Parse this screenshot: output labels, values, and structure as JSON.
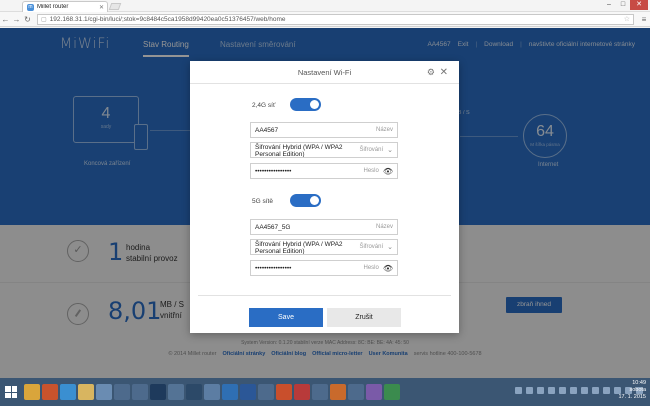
{
  "browser": {
    "tab_title": "Millet router",
    "url": "192.168.31.1/cgi-bin/luci/;stok=9c8484c5ca1958d99420ea0c51376457/web/home"
  },
  "header": {
    "logo": "MiWiFi",
    "tabs": [
      {
        "label": "Stav Routing",
        "active": true
      },
      {
        "label": "Nastavení směrování",
        "active": false
      }
    ],
    "links": [
      "AA4567",
      "Exit",
      "Download",
      "navštivte oficiální internetové stránky"
    ]
  },
  "hero": {
    "devices_count": "4",
    "devices_sub": "sady",
    "devices_label": "Koncová zařízení",
    "speed_tag": "kB / S",
    "internet_count": "64",
    "internet_sub": "M šířka pásma",
    "internet_label": "Internet"
  },
  "status": {
    "uptime_value": "1",
    "uptime_line1": "hodina",
    "uptime_line2": "stabilní provoz",
    "speed_value": "8,01",
    "speed_line1": "MB / S",
    "speed_line2": "vnitřní",
    "measure_button": "zbraň ihned"
  },
  "footer": {
    "version": "System Version: 0.1.20 stabilní verze MAC Address: 8C: BE: BE: 4A: 45: 50",
    "links": [
      "© 2014 Millet router",
      "Oficiální stránky",
      "Oficiální blog",
      "Official micro-letter",
      "User Komunita",
      "servis hotline 400-100-5678"
    ]
  },
  "modal": {
    "title": "Nastavení Wi-Fi",
    "band24": {
      "label": "2,4G síť",
      "enabled": true,
      "name_value": "AA4567",
      "name_placeholder": "Název",
      "encryption_value": "Šifrování Hybrid (WPA / WPA2 Personal Edition)",
      "encryption_placeholder": "Šifrování",
      "password_value": "••••••••••••••••",
      "password_placeholder": "Heslo"
    },
    "band5": {
      "label": "5G sítě",
      "enabled": true,
      "name_value": "AA4567_5G",
      "name_placeholder": "Název",
      "encryption_value": "Šifrování Hybrid (WPA / WPA2 Personal Edition)",
      "encryption_placeholder": "Šifrování",
      "password_value": "••••••••••••••••",
      "password_placeholder": "Heslo"
    },
    "save_label": "Save",
    "cancel_label": "Zrušit"
  },
  "taskbar": {
    "time": "10:49",
    "day": "sobota",
    "date": "17. 1. 2015"
  },
  "colors": {
    "brand_blue": "#2a6dc4",
    "taskbar": "#3b5673"
  }
}
